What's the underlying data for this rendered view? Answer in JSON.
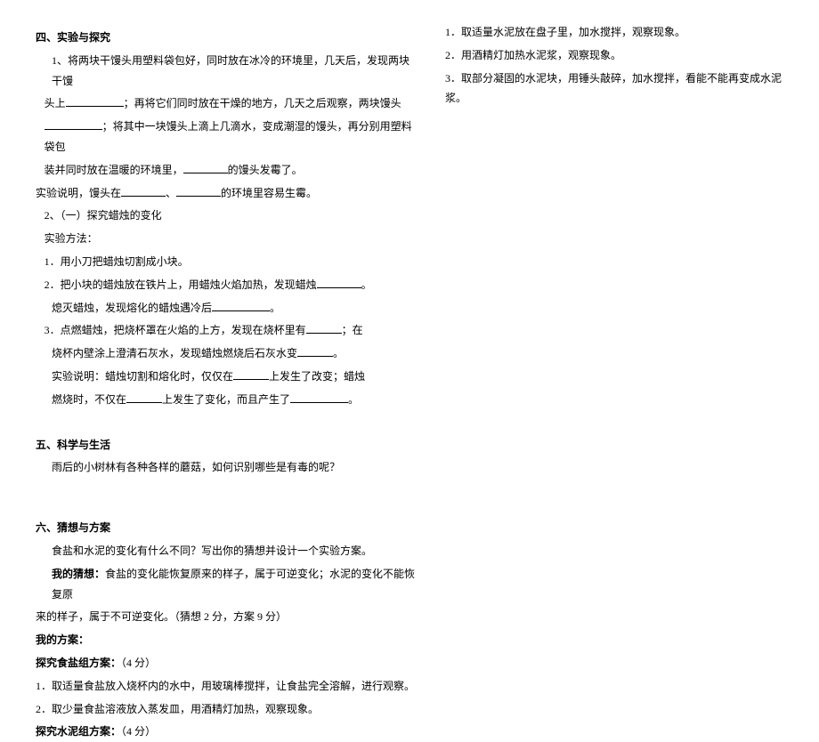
{
  "section4": {
    "title": "四、实验与探究",
    "q1": {
      "line1a": "1、将两块干馒头用塑料袋包好，同时放在冰冷的环境里，几天后，发现两块干馒",
      "line1b": "头上",
      "line1c": "；再将它们同时放在干燥的地方，几天之后观察，两块馒头",
      "line2a": "",
      "line2b": "；将其中一块馒头上滴上几滴水，变成潮湿的馒头，再分别用塑料袋包",
      "line3a": "装并同时放在温暖的环境里，",
      "line3b": "的馒头发霉了。"
    },
    "exp_summary": {
      "pre": "实验说明，馒头在",
      "mid": "、",
      "post": "的环境里容易生霉。"
    },
    "sub": {
      "heading": "2、（一）探究蜡烛的变化",
      "method_label": "实验方法：",
      "s1": "1．用小刀把蜡烛切割成小块。",
      "s2a": "2．把小块的蜡烛放在铁片上，用蜡烛火焰加热，发现蜡烛",
      "s2b": "。",
      "s2c": "熄灭蜡烛，发现熔化的蜡烛遇冷后",
      "s2d": "。",
      "s3a": "3．点燃蜡烛，把烧杯罩在火焰的上方，发现在烧杯里有",
      "s3b": "；在",
      "s3c": "烧杯内壁涂上澄清石灰水，发现蜡烛燃烧后石灰水变",
      "s3d": "。",
      "s4a": "实验说明：蜡烛切割和熔化时，仅仅在",
      "s4b": "上发生了改变；蜡烛",
      "s4c": "燃烧时，不仅在",
      "s4d": "上发生了变化，而且产生了",
      "s4e": "。"
    }
  },
  "section5": {
    "title": "五、科学与生活",
    "text": "雨后的小树林有各种各样的蘑菇，如何识别哪些是有毒的呢？"
  },
  "section6": {
    "title": "六、猜想与方案",
    "intro": "食盐和水泥的变化有什么不同？写出你的猜想并设计一个实验方案。",
    "guess_label": "我的猜想：",
    "guess_text1": "食盐的变化能恢复原来的样子，属于可逆变化；水泥的变化不能恢复原",
    "guess_text2": "来的样子，属于不可逆变化。（猜想 2 分，方案 9 分）",
    "plan_label": "我的方案：",
    "salt_plan_label": "探究食盐组方案：",
    "salt_plan_score": "（4 分）",
    "salt_plan_1": "1．取适量食盐放入烧杯内的水中，用玻璃棒搅拌，让食盐完全溶解，进行观察。",
    "salt_plan_2": "2．取少量食盐溶液放入蒸发皿，用酒精灯加热，观察现象。",
    "cement_plan_label": "探究水泥组方案：",
    "cement_plan_score": "（4 分）"
  },
  "right": {
    "cement_1": "1．取适量水泥放在盘子里，加水搅拌，观察现象。",
    "cement_2": "2．用酒精灯加热水泥浆，观察现象。",
    "cement_3": "3．取部分凝固的水泥块，用锤头敲碎，加水搅拌，看能不能再变成水泥浆。"
  }
}
